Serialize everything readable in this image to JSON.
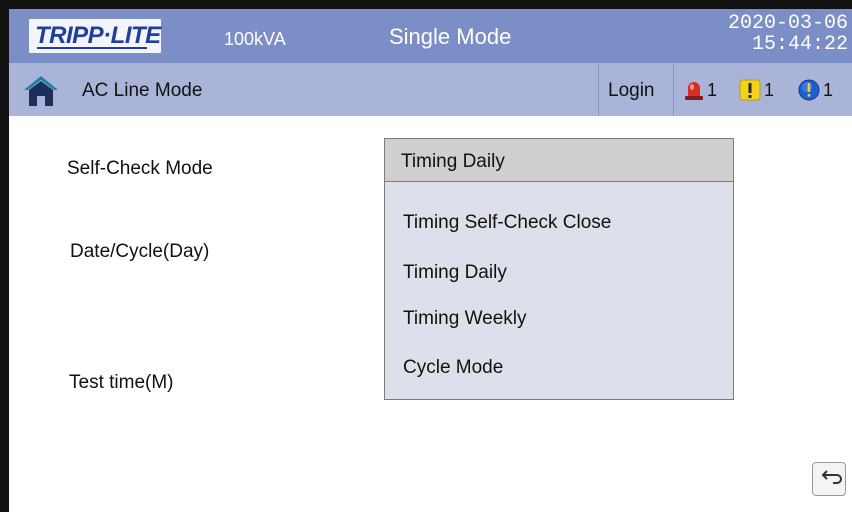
{
  "header": {
    "logo_text": "TRIPP·LITE",
    "capacity": "100kVA",
    "mode": "Single Mode",
    "date": "2020-03-06",
    "time": "15:44:22"
  },
  "statusbar": {
    "mode_text": "AC Line Mode",
    "login_label": "Login",
    "alarms": [
      {
        "icon": "red-alarm-icon",
        "count": "1"
      },
      {
        "icon": "yellow-warning-icon",
        "count": "1"
      },
      {
        "icon": "blue-info-icon",
        "count": "1"
      }
    ]
  },
  "form": {
    "self_check_label": "Self-Check Mode",
    "date_cycle_label": "Date/Cycle(Day)",
    "test_time_label": "Test time(M)",
    "selected_value": "Timing Daily",
    "options": [
      "Timing Self-Check Close",
      "Timing Daily",
      "Timing Weekly",
      "Cycle Mode"
    ]
  },
  "colors": {
    "titlebar": "#7b8ec6",
    "statusbar": "#aab4d8",
    "dropdown_bg": "#dde0ea",
    "select_bg": "#cfcfcf"
  }
}
